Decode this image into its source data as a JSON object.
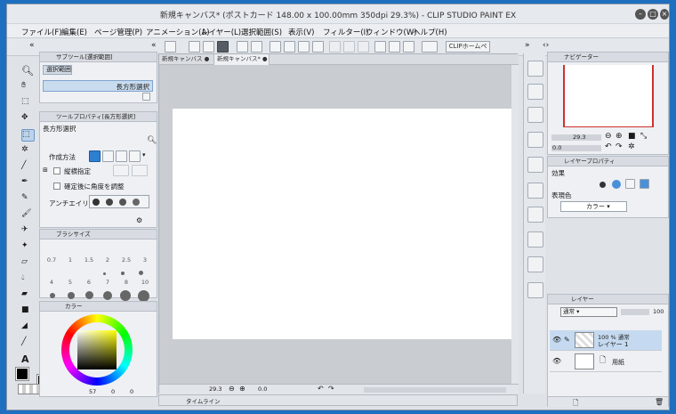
{
  "window": {
    "title": "新規キャンバス* (ポストカード 148.00 x 100.00mm 350dpi 29.3%) - CLIP STUDIO PAINT EX"
  },
  "menu": [
    "ファイル(F)",
    "編集(E)",
    "ページ管理(P)",
    "アニメーション(A)",
    "レイヤー(L)",
    "選択範囲(S)",
    "表示(V)",
    "フィルター(I)",
    "ウィンドウ(W)",
    "ヘルプ(H)"
  ],
  "command_bar": {
    "home_label": "CLIPホームページ"
  },
  "sub_tool_panel": {
    "title": "サブツール[選択範囲]",
    "group": "選択範囲",
    "item": "長方形選択"
  },
  "tool_property": {
    "title": "ツールプロパティ[長方形選択]",
    "name": "長方形選択",
    "mode_label": "作成方法",
    "aspect_label": "縦横指定",
    "adjust_label": "確定後に角度を調整",
    "antialias_label": "アンチエイリ"
  },
  "brush_size": {
    "title": "ブラシサイズ",
    "values": [
      "0.7",
      "1",
      "1.5",
      "2",
      "2.5",
      "3",
      "4",
      "5",
      "6",
      "7",
      "8",
      "10"
    ]
  },
  "color": {
    "tab_label": "カラー",
    "fg_value": "57",
    "mid_value": "0",
    "bg_value": "0",
    "main_color": "#000000"
  },
  "canvas": {
    "tabs": [
      "新規キャンバス",
      "新規キャンバス*"
    ],
    "zoom": "29.3",
    "angle": "0.0"
  },
  "timeline": {
    "label": "タイムライン"
  },
  "navigator": {
    "title": "ナビゲーター",
    "zoom": "29.3",
    "angle": "0.0"
  },
  "layer_property": {
    "title": "レイヤープロパティ",
    "effect_label": "効果",
    "expression_label": "表現色",
    "expression_value": "カラー"
  },
  "layers": {
    "tab_label": "レイヤー",
    "blend_mode": "通常",
    "opacity": "100",
    "items": [
      {
        "meta": "100 % 通常",
        "name": "レイヤー 1"
      },
      {
        "meta": "",
        "name": "用紙"
      }
    ]
  }
}
